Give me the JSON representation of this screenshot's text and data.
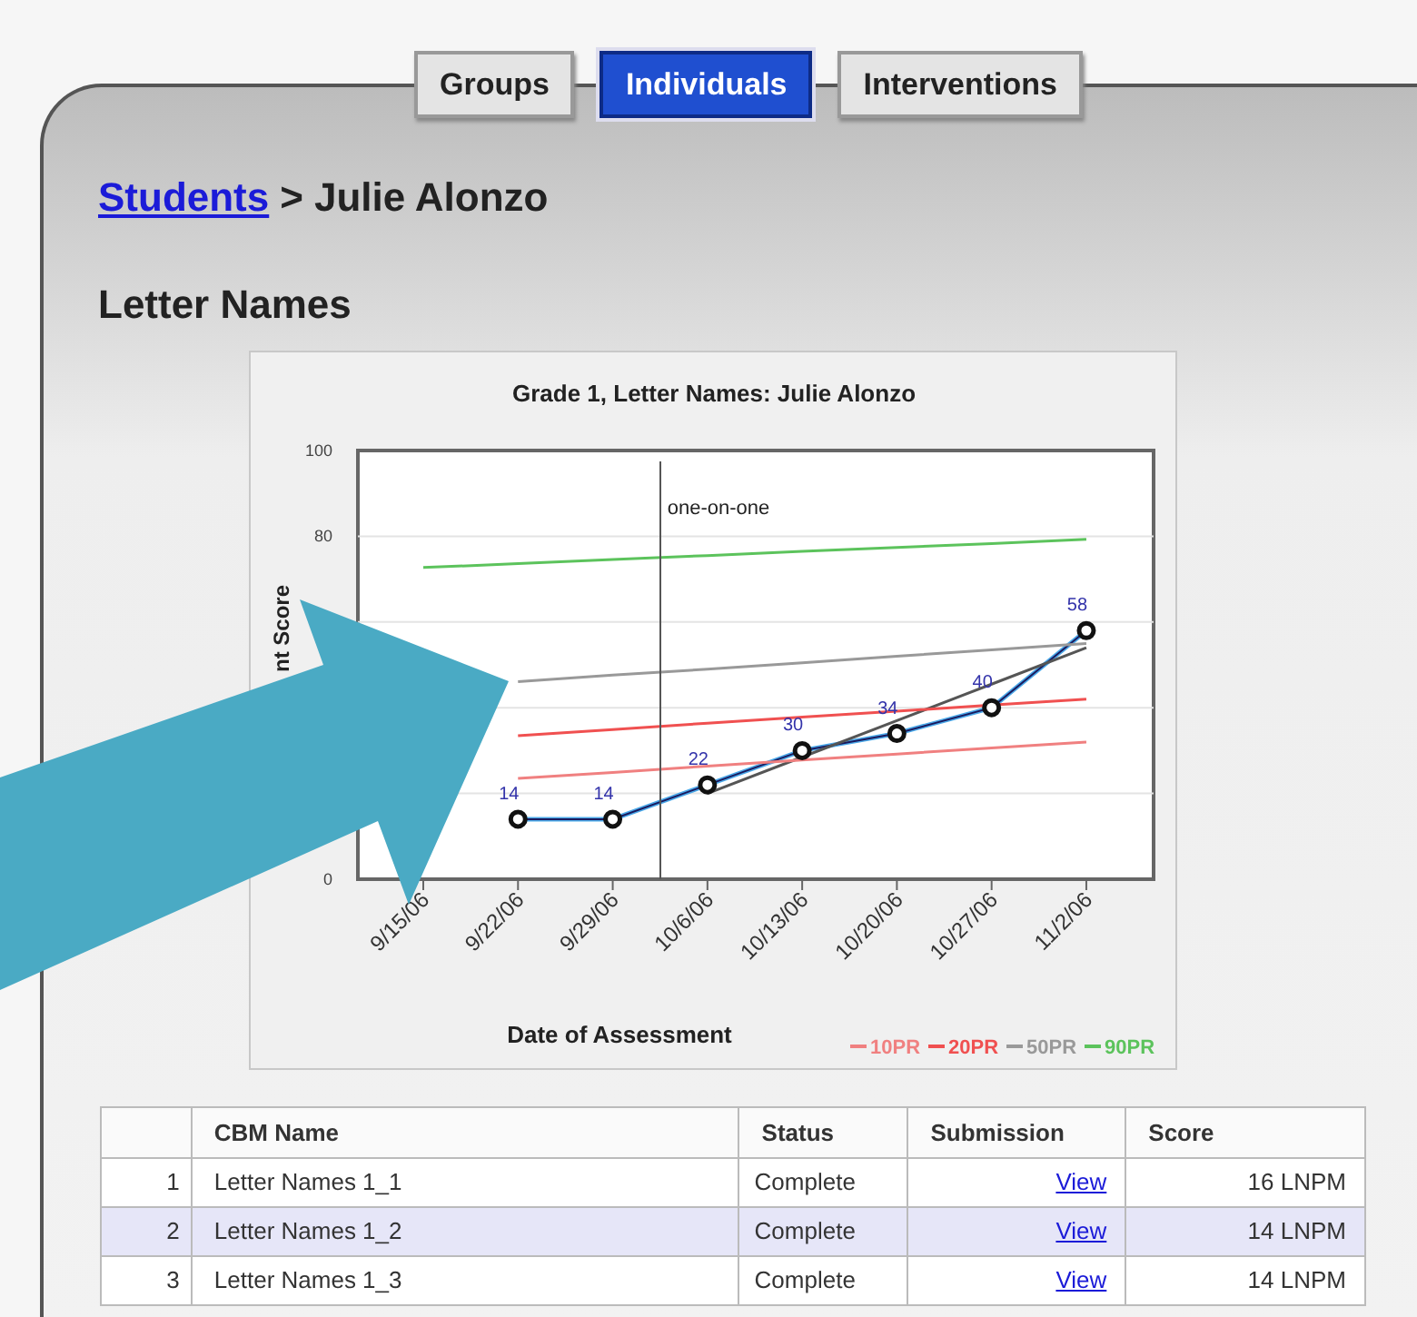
{
  "tabs": [
    {
      "label": "Groups",
      "selected": false
    },
    {
      "label": "Individuals",
      "selected": true
    },
    {
      "label": "Interventions",
      "selected": false
    }
  ],
  "breadcrumb": {
    "link": "Students",
    "separator": ">",
    "current": "Julie Alonzo"
  },
  "heading": "Letter Names",
  "chart": {
    "chart_data": {
      "type": "line",
      "title": "Grade 1, Letter Names: Julie Alonzo",
      "xlabel": "Date of Assessment",
      "ylabel": "nt Score",
      "categories": [
        "9/15/06",
        "9/22/06",
        "9/29/06",
        "10/6/06",
        "10/13/06",
        "10/20/06",
        "10/27/06",
        "11/2/06"
      ],
      "ylim": [
        0,
        100
      ],
      "yticks": [
        0,
        80,
        100
      ],
      "annotations": [
        "one-on-one"
      ],
      "legend": true,
      "series": [
        {
          "color": "#1a1a5e",
          "marker": "circle",
          "values": [
            null,
            14,
            14,
            22,
            30,
            34,
            40,
            58
          ],
          "value_labels": [
            null,
            "14",
            "14",
            "22",
            "30",
            "34",
            "40",
            "58"
          ]
        },
        {
          "color": "#555555",
          "values": [
            null,
            null,
            null,
            20,
            28.5,
            37,
            45.5,
            54
          ]
        },
        {
          "name": "10PR",
          "color": "#f08080",
          "values": [
            null,
            23.5,
            24.9,
            26.4,
            27.8,
            29.2,
            30.6,
            32.0
          ]
        },
        {
          "name": "20PR",
          "color": "#f05050",
          "values": [
            null,
            33.5,
            34.9,
            36.4,
            37.8,
            39.2,
            40.6,
            42.0
          ]
        },
        {
          "name": "50PR",
          "color": "#999999",
          "values": [
            null,
            46.1,
            47.6,
            49.0,
            50.5,
            52.0,
            53.5,
            55.0
          ]
        },
        {
          "name": "90PR",
          "color": "#5cc35c",
          "values": [
            72.7,
            73.6,
            74.6,
            75.5,
            76.5,
            77.4,
            78.3,
            79.3
          ]
        }
      ]
    }
  },
  "table": {
    "columns": [
      "CBM Name",
      "Status",
      "Submission",
      "Score"
    ],
    "rows": [
      {
        "index": "1",
        "name": "Letter Names 1_1",
        "status": "Complete",
        "submission": "View",
        "score": "16 LNPM",
        "selected": false
      },
      {
        "index": "2",
        "name": "Letter Names 1_2",
        "status": "Complete",
        "submission": "View",
        "score": "14 LNPM",
        "selected": true
      },
      {
        "index": "3",
        "name": "Letter Names 1_3",
        "status": "Complete",
        "submission": "View",
        "score": "14 LNPM",
        "selected": false
      }
    ]
  }
}
